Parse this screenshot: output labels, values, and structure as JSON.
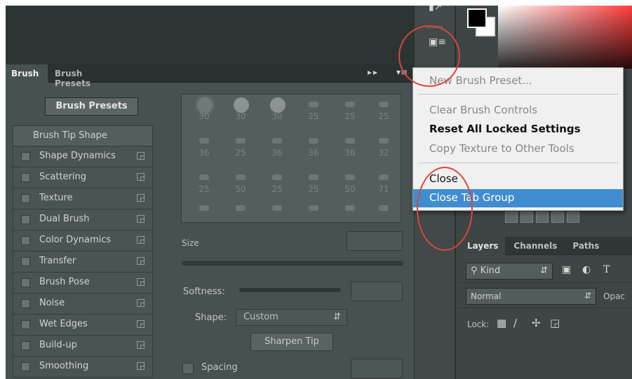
{
  "brush_panel": {
    "tabs": [
      "Brush",
      "Brush Presets"
    ],
    "tab_controls": "▸▸",
    "menu_icon": "▾≡",
    "presets_button": "Brush Presets",
    "list_header": "Brush Tip Shape",
    "list_items": [
      "Shape Dynamics",
      "Scattering",
      "Texture",
      "Dual Brush",
      "Color Dynamics",
      "Transfer",
      "Brush Pose",
      "Noise",
      "Wet Edges",
      "Build-up",
      "Smoothing"
    ],
    "brush_tip_sizes_row1": [
      "30",
      "30",
      "30",
      "25",
      "25",
      "25"
    ],
    "brush_tip_sizes_row2": [
      "36",
      "25",
      "36",
      "36",
      "36",
      "32"
    ],
    "brush_tip_sizes_row3": [
      "25",
      "50",
      "25",
      "25",
      "50",
      "71"
    ],
    "size_label": "Size",
    "softness_label": "Softness:",
    "shape_label": "Shape:",
    "shape_value": "Custom",
    "sharpen_button": "Sharpen Tip",
    "spacing_label": "Spacing"
  },
  "context_menu": {
    "items": [
      {
        "label": "New Brush Preset...",
        "state": "disabled"
      },
      {
        "label": "Clear Brush Controls",
        "state": "disabled"
      },
      {
        "label": "Reset All Locked Settings",
        "state": "enabled"
      },
      {
        "label": "Copy Texture to Other Tools",
        "state": "disabled"
      },
      {
        "label": "Close",
        "state": "normal"
      },
      {
        "label": "Close Tab Group",
        "state": "highlighted"
      }
    ]
  },
  "layers_panel": {
    "tabs": [
      "Layers",
      "Channels",
      "Paths"
    ],
    "filter_kind": "Kind",
    "blend_mode": "Normal",
    "opacity_label": "Opac",
    "lock_label": "Lock:"
  },
  "colors": {
    "highlight": "#3f8dd0",
    "annotation_circle": "#d9463a",
    "panel_bg": "#485151"
  }
}
